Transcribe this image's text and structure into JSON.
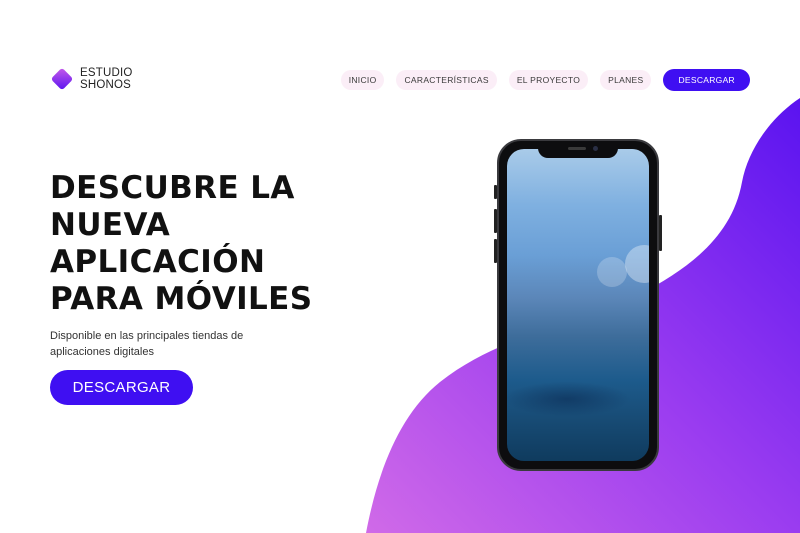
{
  "brand": {
    "line1": "ESTUDIO",
    "line2": "SHONOS",
    "icon": "diamond-logo-icon"
  },
  "nav": {
    "links": [
      {
        "label": "INICIO"
      },
      {
        "label": "CARACTERÍSTICAS"
      },
      {
        "label": "EL PROYECTO"
      },
      {
        "label": "PLANES"
      }
    ],
    "cta_label": "DESCARGAR"
  },
  "hero": {
    "title_lines": [
      "DESCUBRE LA",
      "NUEVA",
      "APLICACIÓN",
      "PARA MÓVILES"
    ],
    "subtitle": "Disponible en las principales tiendas de aplicaciones digitales",
    "cta_label": "DESCARGAR"
  },
  "colors": {
    "accent": "#3f0ff2",
    "nav_pill": "#fbeef7",
    "blob_start": "#c75be8",
    "blob_end": "#5a13f0"
  }
}
